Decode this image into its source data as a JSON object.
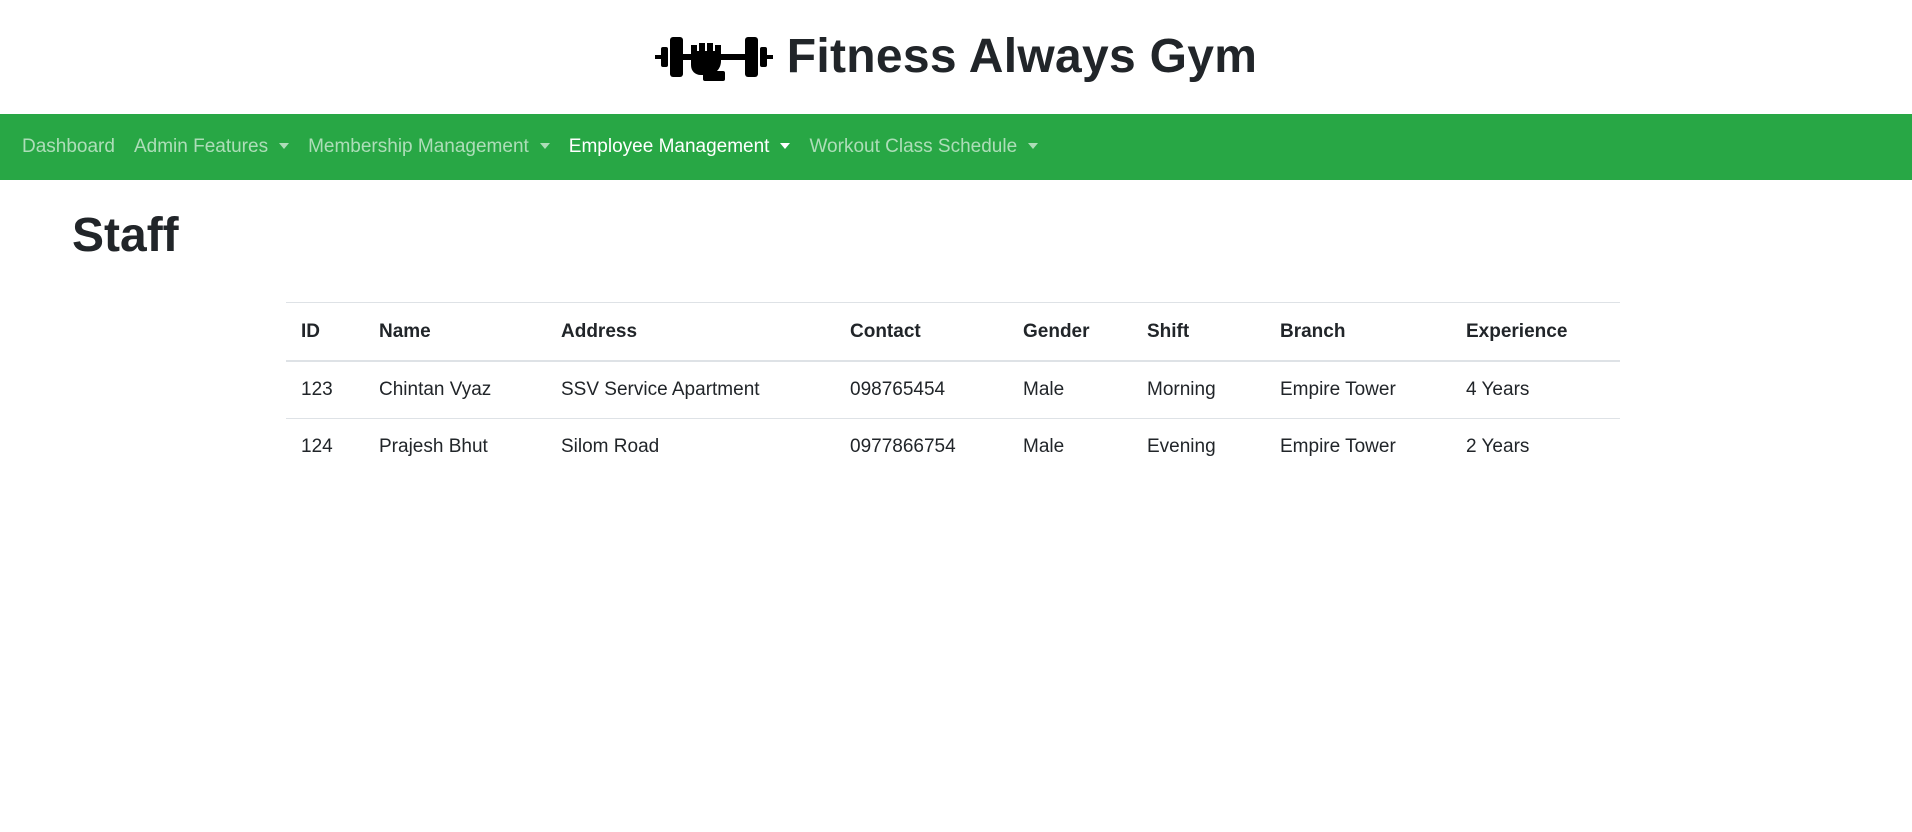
{
  "header": {
    "logo_icon": "dumbbell-fist-icon",
    "title": "Fitness Always Gym"
  },
  "nav": {
    "items": [
      {
        "label": "Dashboard",
        "dropdown": false,
        "active": false
      },
      {
        "label": "Admin Features",
        "dropdown": true,
        "active": false
      },
      {
        "label": "Membership Management",
        "dropdown": true,
        "active": false
      },
      {
        "label": "Employee Management",
        "dropdown": true,
        "active": true
      },
      {
        "label": "Workout Class Schedule",
        "dropdown": true,
        "active": false
      }
    ],
    "color": "#28a745"
  },
  "main": {
    "title": "Staff",
    "table": {
      "headers": [
        "ID",
        "Name",
        "Address",
        "Contact",
        "Gender",
        "Shift",
        "Branch",
        "Experience"
      ],
      "rows": [
        [
          "123",
          "Chintan Vyaz",
          "SSV Service Apartment",
          "098765454",
          "Male",
          "Morning",
          "Empire Tower",
          "4 Years"
        ],
        [
          "124",
          "Prajesh Bhut",
          "Silom Road",
          "0977866754",
          "Male",
          "Evening",
          "Empire Tower",
          "2 Years"
        ]
      ]
    }
  }
}
